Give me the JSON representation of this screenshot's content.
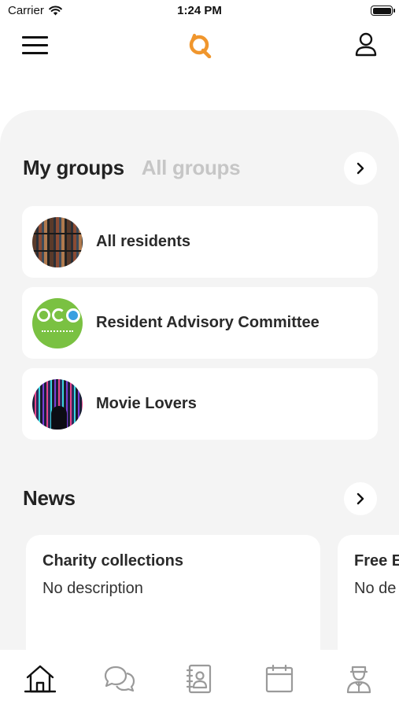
{
  "status_bar": {
    "carrier": "Carrier",
    "time": "1:24 PM"
  },
  "nav": {
    "menu_icon": "hamburger-menu-icon",
    "logo": "app-logo",
    "profile_icon": "user-profile-icon"
  },
  "groups": {
    "title": "My groups",
    "alt_tab": "All groups",
    "items": [
      {
        "name": "All residents",
        "avatar": "bookshelf-photo"
      },
      {
        "name": "Resident Advisory Committee",
        "avatar": "green-logo-photo"
      },
      {
        "name": "Movie Lovers",
        "avatar": "neon-lights-photo"
      }
    ]
  },
  "news": {
    "title": "News",
    "items": [
      {
        "title": "Charity collections",
        "description": "No description"
      },
      {
        "title": "Free E",
        "description": "No de"
      }
    ]
  },
  "tab_bar": {
    "items": [
      "home-icon",
      "chat-icon",
      "contacts-icon",
      "calendar-icon",
      "concierge-icon"
    ],
    "active": "home-icon"
  },
  "colors": {
    "brand": "#f0962d",
    "panel": "#f4f4f4",
    "inactive_tab": "#c6c6c6",
    "icon_gray": "#9a9a9a"
  }
}
